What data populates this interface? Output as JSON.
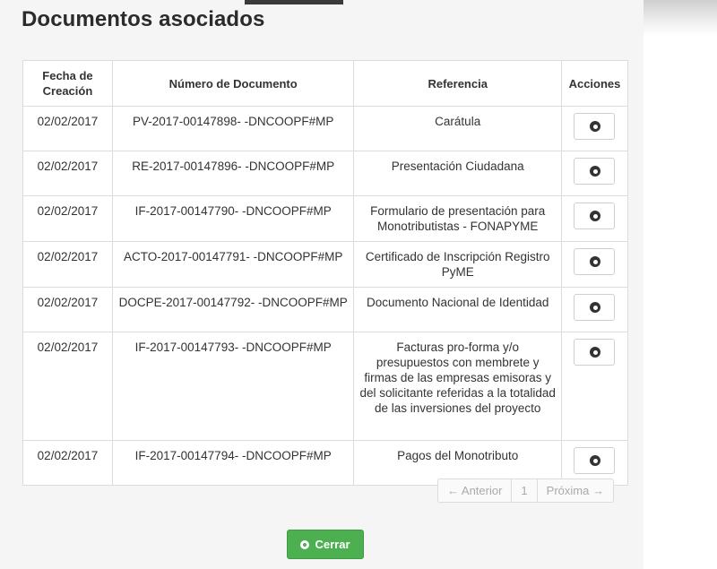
{
  "page": {
    "title": "Documentos asociados"
  },
  "table": {
    "headers": [
      "Fecha de Creación",
      "Número de Documento",
      "Referencia",
      "Acciones"
    ],
    "rows": [
      {
        "fecha": "02/02/2017",
        "numero": "PV-2017-00147898- -DNCOOPF#MP",
        "referencia": "Carátula"
      },
      {
        "fecha": "02/02/2017",
        "numero": "RE-2017-00147896- -DNCOOPF#MP",
        "referencia": "Presentación Ciudadana"
      },
      {
        "fecha": "02/02/2017",
        "numero": "IF-2017-00147790- -DNCOOPF#MP",
        "referencia": "Formulario de presentación para Monotributistas - FONAPYME"
      },
      {
        "fecha": "02/02/2017",
        "numero": "ACTO-2017-00147791- -DNCOOPF#MP",
        "referencia": "Certificado de Inscripción Registro PyME"
      },
      {
        "fecha": "02/02/2017",
        "numero": "DOCPE-2017-00147792- -DNCOOPF#MP",
        "referencia": "Documento Nacional de Identidad"
      },
      {
        "fecha": "02/02/2017",
        "numero": "IF-2017-00147793- -DNCOOPF#MP",
        "referencia": "Facturas pro-forma y/o presupuestos con membrete y firmas de las empresas emisoras y del solicitante referidas a la totalidad de las inversiones del proyecto"
      },
      {
        "fecha": "02/02/2017",
        "numero": "IF-2017-00147794- -DNCOOPF#MP",
        "referencia": "Pagos del Monotributo"
      }
    ]
  },
  "pagination": {
    "prev": "← Anterior",
    "page": "1",
    "next": "Próxima →"
  },
  "footer": {
    "close_label": "Cerrar"
  },
  "icons": {
    "row_action": "circle-dot-icon",
    "close": "circle-dot-icon"
  },
  "colors": {
    "close_button": "#4caf50"
  }
}
